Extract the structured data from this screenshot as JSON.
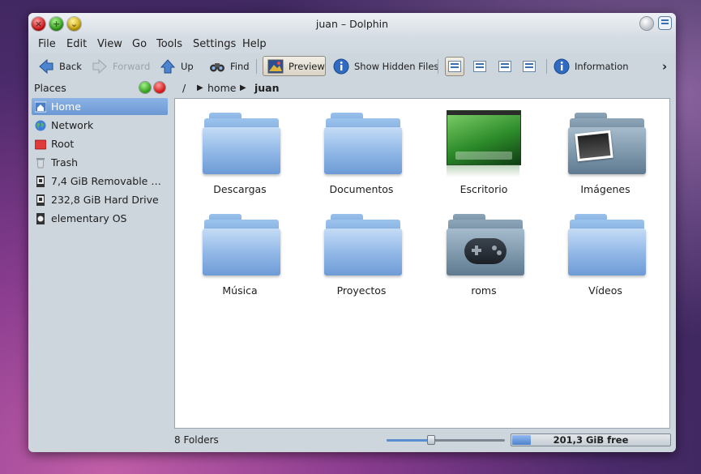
{
  "window": {
    "title": "juan – Dolphin"
  },
  "menubar": {
    "items": [
      "File",
      "Edit",
      "View",
      "Go",
      "Tools",
      "Settings",
      "Help"
    ]
  },
  "toolbar": {
    "back": "Back",
    "forward": "Forward",
    "up": "Up",
    "find": "Find",
    "preview": "Preview",
    "show_hidden": "Show Hidden Files",
    "information": "Information",
    "overflow": "›"
  },
  "places": {
    "title": "Places",
    "items": [
      {
        "label": "Home",
        "icon": "home-icon",
        "selected": true
      },
      {
        "label": "Network",
        "icon": "network-globe-icon"
      },
      {
        "label": "Root",
        "icon": "root-folder-icon"
      },
      {
        "label": "Trash",
        "icon": "trash-icon"
      },
      {
        "label": "7,4 GiB Removable Me...",
        "icon": "removable-drive-icon"
      },
      {
        "label": "232,8 GiB Hard Drive",
        "icon": "hard-drive-icon"
      },
      {
        "label": "elementary OS",
        "icon": "os-drive-icon"
      }
    ]
  },
  "breadcrumb": {
    "root": "/",
    "parts": [
      "home",
      "juan"
    ]
  },
  "files": [
    {
      "name": "Descargas",
      "icon": "folder-icon"
    },
    {
      "name": "Documentos",
      "icon": "folder-icon"
    },
    {
      "name": "Escritorio",
      "icon": "desktop-preview-icon"
    },
    {
      "name": "Imágenes",
      "icon": "pictures-folder-icon"
    },
    {
      "name": "Música",
      "icon": "folder-icon"
    },
    {
      "name": "Proyectos",
      "icon": "folder-icon"
    },
    {
      "name": "roms",
      "icon": "games-folder-icon"
    },
    {
      "name": "Vídeos",
      "icon": "folder-icon"
    }
  ],
  "status": {
    "text": "8 Folders",
    "zoom_fraction": 0.38,
    "free_space": "201,3 GiB free",
    "used_fraction": 0.12
  },
  "colors": {
    "accent": "#6b98d4",
    "folder": "#8fb6e6"
  }
}
